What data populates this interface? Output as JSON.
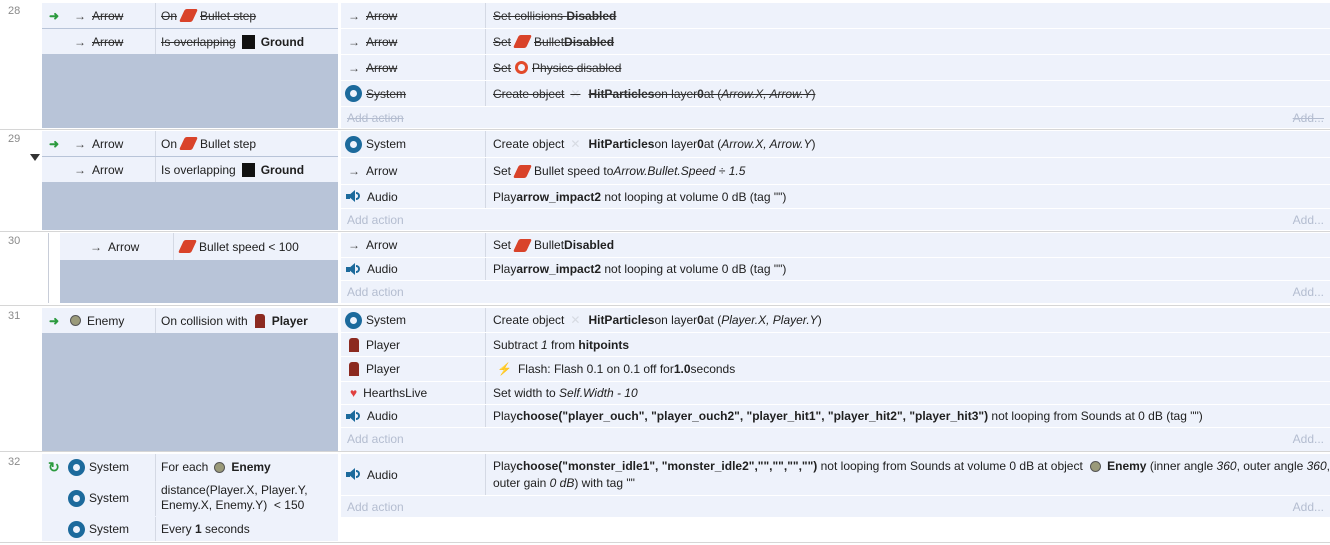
{
  "labels": {
    "add_action": "Add action",
    "add": "Add..."
  },
  "events": {
    "e28": {
      "number": "28",
      "conds": [
        {
          "obj": "Arrow",
          "pre": "On",
          "icon": "bullet",
          "text": "Bullet step"
        },
        {
          "obj": "Arrow",
          "pre": "Is overlapping",
          "icon": "ground",
          "bold": "Ground"
        }
      ],
      "acts": [
        {
          "obj": "Arrow",
          "a": "Set collisions ",
          "b": "Disabled"
        },
        {
          "obj": "Arrow",
          "a": "Set ",
          "b2": "Bullet ",
          "c": "Disabled"
        },
        {
          "obj": "Arrow",
          "a": "Set ",
          "b2": "Physics disabled"
        },
        {
          "obj": "System",
          "a": "Create object ",
          "b": "HitParticles",
          "c": " on layer ",
          "d": "0",
          "e": " at (",
          "f": "Arrow.X, Arrow.Y",
          "g": ")"
        }
      ]
    },
    "e29": {
      "number": "29",
      "conds": [
        {
          "obj": "Arrow",
          "pre": "On",
          "text": "Bullet step"
        },
        {
          "obj": "Arrow",
          "pre": "Is overlapping",
          "bold": "Ground"
        }
      ],
      "acts": [
        {
          "obj": "System",
          "a": "Create object ",
          "b": "HitParticles",
          "c": " on layer ",
          "d": "0",
          "e": " at (",
          "f": "Arrow.X, Arrow.Y",
          "g": ")"
        },
        {
          "obj": "Arrow",
          "a": "Set ",
          "b2": "Bullet speed to ",
          "f": "Arrow.Bullet.Speed ÷ 1.5"
        },
        {
          "obj": "Audio",
          "a": "Play ",
          "b": "arrow_impact2",
          "c": " not looping at volume 0 dB (tag \"\")"
        }
      ]
    },
    "e30": {
      "number": "30",
      "conds": [
        {
          "obj": "Arrow",
          "text": "Bullet speed < 100"
        }
      ],
      "acts": [
        {
          "obj": "Arrow",
          "a": "Set ",
          "b2": "Bullet ",
          "c": "Disabled"
        },
        {
          "obj": "Audio",
          "a": "Play ",
          "b": "arrow_impact2",
          "c": " not looping at volume 0 dB (tag \"\")"
        }
      ]
    },
    "e31": {
      "number": "31",
      "conds": [
        {
          "obj": "Enemy",
          "pre": "On collision with",
          "bold": "Player"
        }
      ],
      "acts": [
        {
          "obj": "System",
          "a": "Create object ",
          "b": "HitParticles",
          "c": " on layer ",
          "d": "0",
          "e": " at (",
          "f": "Player.X, Player.Y",
          "g": ")"
        },
        {
          "obj": "Player",
          "a": "Subtract ",
          "f": "1",
          "c": " from ",
          "b": "hitpoints"
        },
        {
          "obj": "Player",
          "a": "Flash: Flash 0.1 on 0.1 off for ",
          "b": "1.0",
          "c": " seconds"
        },
        {
          "obj": "HearthsLive",
          "a": "Set width to ",
          "f": "Self.Width - 10"
        },
        {
          "obj": "Audio",
          "a": "Play ",
          "b": "choose(\"player_ouch\", \"player_ouch2\", \"player_hit1\", \"player_hit2\", \"player_hit3\")",
          "c": " not looping from Sounds at 0 dB (tag \"\")"
        }
      ]
    },
    "e32": {
      "number": "32",
      "conds": [
        {
          "obj": "System",
          "pre": "For each",
          "bold": "Enemy"
        },
        {
          "obj": "System",
          "text1": "distance(Player.X, Player.Y,",
          "text2": "Enemy.X, Enemy.Y)  < 150"
        },
        {
          "obj": "System",
          "pre": "Every ",
          "bold": "1",
          "post": " seconds"
        }
      ],
      "acts": [
        {
          "obj": "Audio",
          "a": "Play ",
          "b": "choose(\"monster_idle1\", \"monster_idle2\",\"\",\"\",\"\",\"\")",
          "c": " not looping from Sounds at volume 0 dB at object ",
          "d": "Enemy",
          "e": " (inner angle ",
          "f": "360",
          "g": ", outer angle ",
          "h": "360",
          "i": ",",
          "line2a": "outer gain ",
          "line2b": "0 dB",
          "line2c": ") with tag \"\""
        }
      ]
    }
  }
}
